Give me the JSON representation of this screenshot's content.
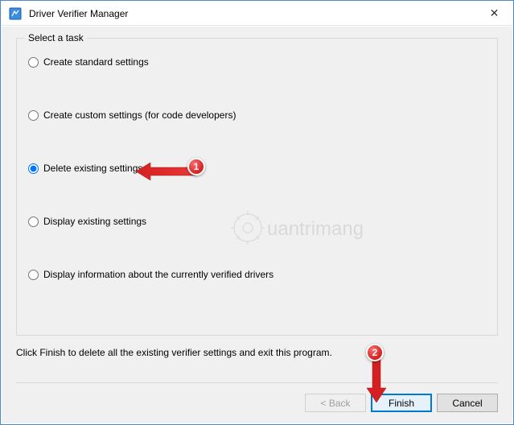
{
  "window": {
    "title": "Driver Verifier Manager",
    "close_glyph": "✕"
  },
  "group": {
    "legend": "Select a task"
  },
  "tasks": {
    "standard": {
      "label": "Create standard settings"
    },
    "custom": {
      "label": "Create custom settings (for code developers)"
    },
    "delete": {
      "label": "Delete existing settings"
    },
    "display": {
      "label": "Display existing settings"
    },
    "info": {
      "label": "Display information about the currently verified drivers"
    }
  },
  "selected_task": "delete",
  "instruction": "Click Finish to delete all the existing verifier settings and exit this program.",
  "buttons": {
    "back": "< Back",
    "finish": "Finish",
    "cancel": "Cancel"
  },
  "annotations": {
    "step1": "1",
    "step2": "2",
    "watermark": "uantrimang"
  }
}
